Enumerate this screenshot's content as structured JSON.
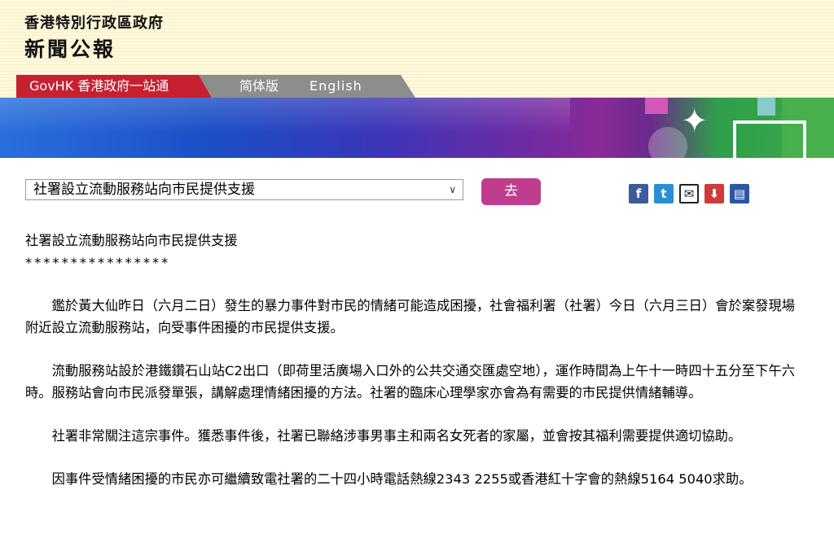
{
  "header": {
    "gov_name": "香港特別行政區政府",
    "section_name": "新聞公報"
  },
  "nav": {
    "govhk": "GovHK 香港政府一站通",
    "simplified": "简体版",
    "english": "English"
  },
  "toolbar": {
    "selected_option": "社署設立流動服務站向市民提供支援",
    "go_label": "去",
    "share_icons": [
      "facebook-icon",
      "twitter-icon",
      "email-icon",
      "pdf-icon",
      "print-icon"
    ]
  },
  "colors": {
    "nav_red": "#c62031",
    "nav_grey": "#8d8d8d",
    "go_button": "#c03d8e"
  },
  "article": {
    "title": "社署設立流動服務站向市民提供支援",
    "stars": "****************",
    "paragraphs": [
      "鑑於黃大仙昨日（六月二日）發生的暴力事件對市民的情緒可能造成困擾，社會福利署（社署）今日（六月三日）會於案發現場附近設立流動服務站，向受事件困擾的市民提供支援。",
      "流動服務站設於港鐵鑽石山站C2出口（即荷里活廣場入口外的公共交通交匯處空地），運作時間為上午十一時四十五分至下午六時。服務站會向市民派發單張，講解處理情緒困擾的方法。社署的臨床心理學家亦會為有需要的市民提供情緒輔導。",
      "社署非常關注這宗事件。獲悉事件後，社署已聯絡涉事男事主和兩名女死者的家屬，並會按其福利需要提供適切協助。",
      "因事件受情緒困擾的市民亦可繼續致電社署的二十四小時電話熱線2343 2255或香港紅十字會的熱線5164 5040求助。"
    ]
  }
}
